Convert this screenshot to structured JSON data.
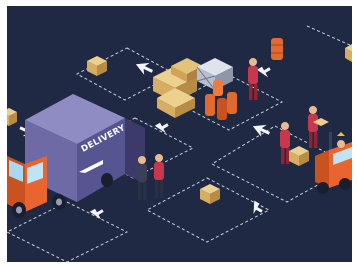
{
  "scene": {
    "truck_text": "DELIVERY",
    "colors": {
      "background": "#1f2944",
      "dashed_path": "#e9edf7",
      "arrow": "#f3f5fb",
      "truck_cargo": "#6d6aa6",
      "truck_cab": "#e9642e",
      "box": "#d9b56c",
      "barrel": "#e06a2f",
      "worker_uniform": "#c8384c",
      "forklift": "#e9642e"
    }
  }
}
